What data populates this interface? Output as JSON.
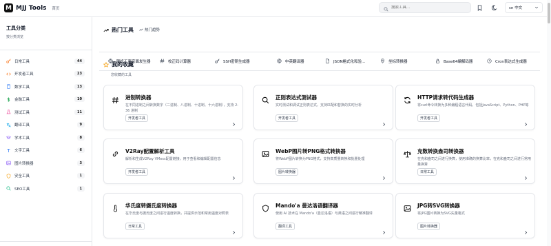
{
  "header": {
    "logo_letter": "M",
    "brand": "MJJ Tools",
    "home": "首页",
    "search_placeholder": "搜索工具...",
    "lang": "中文",
    "lang_prefix": "cn"
  },
  "sidebar": {
    "title": "工具分类",
    "subtitle": "按分类浏览",
    "items": [
      {
        "label": "日常工具",
        "count": "44",
        "icon": "key-icon",
        "color": "#f97316"
      },
      {
        "label": "开发者工具",
        "count": "23",
        "icon": "code-icon",
        "color": "#f97316"
      },
      {
        "label": "数学工具",
        "count": "13",
        "icon": "calculator-icon",
        "color": "#3b82f6"
      },
      {
        "label": "金融工具",
        "count": "10",
        "icon": "dollar-icon",
        "color": "#16a34a"
      },
      {
        "label": "测试工具",
        "count": "11",
        "icon": "flask-icon",
        "color": "#ec4899"
      },
      {
        "label": "翻译工具",
        "count": "9",
        "icon": "translate-icon",
        "color": "#0ea5e9"
      },
      {
        "label": "学术工具",
        "count": "8",
        "icon": "graduation-icon",
        "color": "#8b5cf6"
      },
      {
        "label": "文字工具",
        "count": "6",
        "icon": "text-icon",
        "color": "#3b82f6"
      },
      {
        "label": "图片转换器",
        "count": "3",
        "icon": "image-icon",
        "color": "#8b5cf6"
      },
      {
        "label": "安全工具",
        "count": "1",
        "icon": "shield-icon",
        "color": "#f59e0b"
      },
      {
        "label": "SEO工具",
        "count": "1",
        "icon": "search-icon",
        "color": "#10b981"
      }
    ]
  },
  "hot": {
    "title": "热门工具",
    "tag": "热门趋势",
    "chips": [
      {
        "label": "随机工事实面发生器",
        "icon": "globe-icon"
      },
      {
        "label": "校正码计算器",
        "icon": "hash-icon"
      },
      {
        "label": "SSH密钥生成器",
        "icon": "key-icon"
      },
      {
        "label": "中英翻译器",
        "icon": "globe-icon"
      },
      {
        "label": "JSON格式化和验...",
        "icon": "file-icon"
      },
      {
        "label": "坐标转换器",
        "icon": "pin-icon"
      },
      {
        "label": "Base64编解码器",
        "icon": "lock-icon"
      },
      {
        "label": "Cron表达式生成器",
        "icon": "clock-icon"
      }
    ]
  },
  "favorites": {
    "title": "我的收藏",
    "subtitle": "您收藏的工具",
    "cards": [
      {
        "title": "进制转换器",
        "desc": "在不同进制之间转换数字（二进制、八进制、十进制、十六进制），支持 2-36 进制",
        "tag": "开发者工具",
        "icon": "hash-icon"
      },
      {
        "title": "正则表达式测试器",
        "desc": "实时测试和调试正则表达式，支持匹配和替换的实时分析",
        "tag": "开发者工具",
        "icon": "search-icon"
      },
      {
        "title": "HTTP请求转代码生成器",
        "desc": "将curl命令转换为多种编程语言代码，包括JavaScript、Python、PHP等",
        "tag": "开发者工具",
        "icon": "refresh-icon"
      },
      {
        "title": "V2Ray配置解析工具",
        "desc": "解析和生成V2Ray VMess配置链接，用于查看和编辑配置信息",
        "tag": "开发者工具",
        "icon": "link-icon"
      },
      {
        "title": "WebP图片转PNG格式转换器",
        "desc": "将WebP图片转换为PNG格式，支持高质量转换和批量处理",
        "tag": "图片转换器",
        "icon": "image-icon"
      },
      {
        "title": "克数转换盎司转换器",
        "desc": "在克和盎司之间进行换算，使用准确的换算比率，在克和盎司之间进行常用量换算",
        "tag": "日常工具",
        "icon": "scale-icon"
      },
      {
        "title": "华氏度转摄氏度转换器",
        "desc": "在华氏度与摄氏度之间进行温度转换，并提供示范和常用温度对照表",
        "tag": "日常工具",
        "icon": "thermometer-icon"
      },
      {
        "title": "Mando'a 曼达洛语翻译器",
        "desc": "使用 AI 技术在 Mando'a（曼达洛语）与英语之间进行精准翻译",
        "tag": "翻译工具",
        "icon": "shield-icon"
      },
      {
        "title": "JPG转SVG转换器",
        "desc": "将JPG图片转换为SVG矢量格式",
        "tag": "图片转换器",
        "icon": "image-icon"
      }
    ]
  }
}
